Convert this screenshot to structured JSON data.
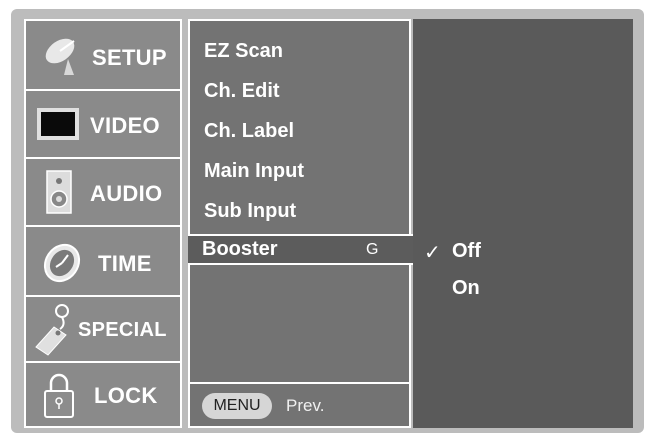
{
  "sidebar": {
    "items": [
      {
        "label": "SETUP",
        "icon": "satellite-dish-icon"
      },
      {
        "label": "VIDEO",
        "icon": "tv-screen-icon"
      },
      {
        "label": "AUDIO",
        "icon": "speaker-icon"
      },
      {
        "label": "TIME",
        "icon": "clock-icon"
      },
      {
        "label": "SPECIAL",
        "icon": "key-tag-icon"
      },
      {
        "label": "LOCK",
        "icon": "padlock-icon"
      }
    ]
  },
  "menu": {
    "items": [
      "EZ Scan",
      "Ch. Edit",
      "Ch. Label",
      "Main Input",
      "Sub Input"
    ],
    "selected": {
      "label": "Booster",
      "key_hint": "G"
    }
  },
  "options": {
    "check": "✓",
    "items": [
      "Off",
      "On"
    ]
  },
  "footer": {
    "menu_button": "MENU",
    "prev_label": "Prev."
  },
  "colors": {
    "osd_bg": "#bcbcbc",
    "sidebar_bg": "#8a8a8a",
    "panel_bg": "#737373",
    "selected_bg": "#5c5c5c",
    "options_bg": "#5a5a5a"
  }
}
